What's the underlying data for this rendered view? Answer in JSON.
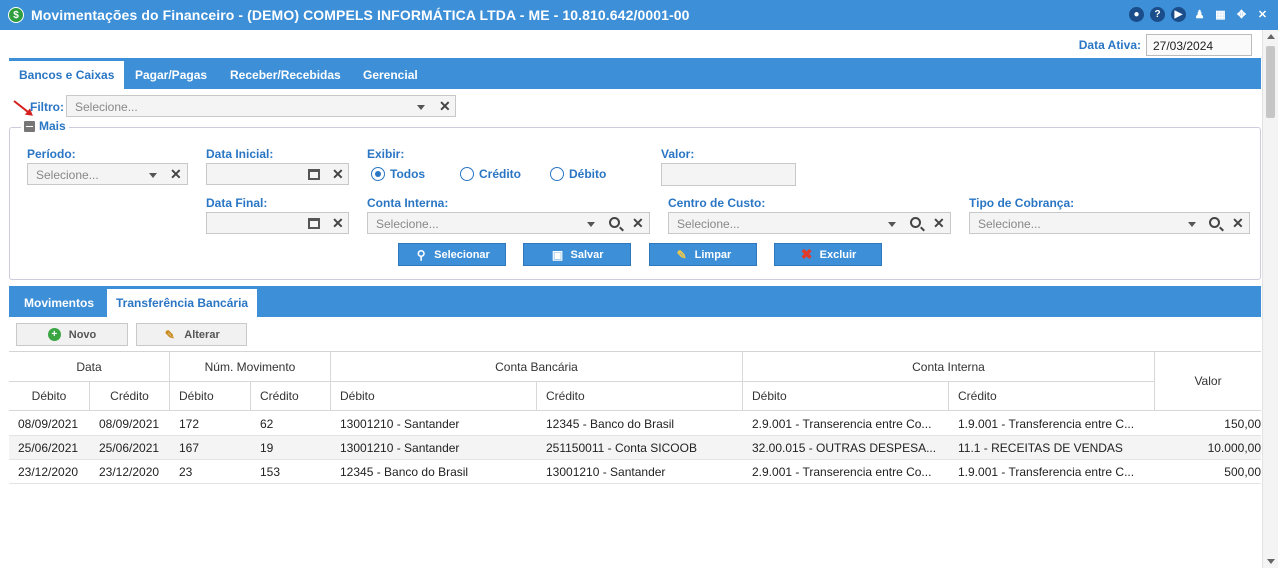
{
  "window": {
    "title": "Movimentações do Financeiro - (DEMO) COMPELS INFORMÁTICA LTDA - ME - 10.810.642/0001-00",
    "app_icon": "$",
    "icons": [
      "eye-icon",
      "help-icon",
      "play-icon",
      "user-icon",
      "calendar-icon",
      "fullscreen-icon",
      "close-icon"
    ]
  },
  "active_date": {
    "label": "Data Ativa:",
    "value": "27/03/2024"
  },
  "main_tabs": [
    {
      "label": "Bancos e Caixas",
      "active": true
    },
    {
      "label": "Pagar/Pagas",
      "active": false
    },
    {
      "label": "Receber/Recebidas",
      "active": false
    },
    {
      "label": "Gerencial",
      "active": false
    }
  ],
  "filter": {
    "label": "Filtro:",
    "placeholder": "Selecione..."
  },
  "more": {
    "label": "Mais"
  },
  "form": {
    "periodo": {
      "label": "Período:",
      "placeholder": "Selecione..."
    },
    "data_inicial": {
      "label": "Data Inicial:",
      "value": ""
    },
    "data_final": {
      "label": "Data Final:",
      "value": ""
    },
    "exibir": {
      "label": "Exibir:",
      "options": [
        "Todos",
        "Crédito",
        "Débito"
      ],
      "selected": "Todos"
    },
    "valor": {
      "label": "Valor:",
      "value": ""
    },
    "conta_interna": {
      "label": "Conta Interna:",
      "placeholder": "Selecione..."
    },
    "centro_custo": {
      "label": "Centro de Custo:",
      "placeholder": "Selecione..."
    },
    "tipo_cobranca": {
      "label": "Tipo de Cobrança:",
      "placeholder": "Selecione..."
    }
  },
  "actions": {
    "selecionar": "Selecionar",
    "salvar": "Salvar",
    "limpar": "Limpar",
    "excluir": "Excluir"
  },
  "sub_tabs": [
    {
      "label": "Movimentos",
      "active": false
    },
    {
      "label": "Transferência Bancária",
      "active": true
    }
  ],
  "grid_actions": {
    "novo": "Novo",
    "alterar": "Alterar"
  },
  "table": {
    "group_headers": {
      "data": "Data",
      "num_movimento": "Núm. Movimento",
      "conta_bancaria": "Conta Bancária",
      "conta_interna": "Conta Interna",
      "valor": "Valor"
    },
    "sub_headers": [
      "Débito",
      "Crédito",
      "Débito",
      "Crédito",
      "Débito",
      "Crédito",
      "Débito",
      "Crédito"
    ],
    "rows": [
      [
        "08/09/2021",
        "08/09/2021",
        "172",
        "62",
        "13001210 - Santander",
        "12345 - Banco do Brasil",
        "2.9.001 - Transerencia entre Co...",
        "1.9.001 - Transferencia entre C...",
        "150,00"
      ],
      [
        "25/06/2021",
        "25/06/2021",
        "167",
        "19",
        "13001210 - Santander",
        "251150011 - Conta SICOOB",
        "32.00.015 - OUTRAS DESPESA...",
        "11.1 - RECEITAS DE VENDAS",
        "10.000,00"
      ],
      [
        "23/12/2020",
        "23/12/2020",
        "23",
        "153",
        "12345 - Banco do Brasil",
        "13001210 - Santander",
        "2.9.001 - Transerencia entre Co...",
        "1.9.001 - Transferencia entre C...",
        "500,00"
      ]
    ]
  },
  "colors": {
    "primary": "#3d8fd8",
    "label": "#2a76c4",
    "close": "#d62020",
    "add": "#3aa542"
  }
}
